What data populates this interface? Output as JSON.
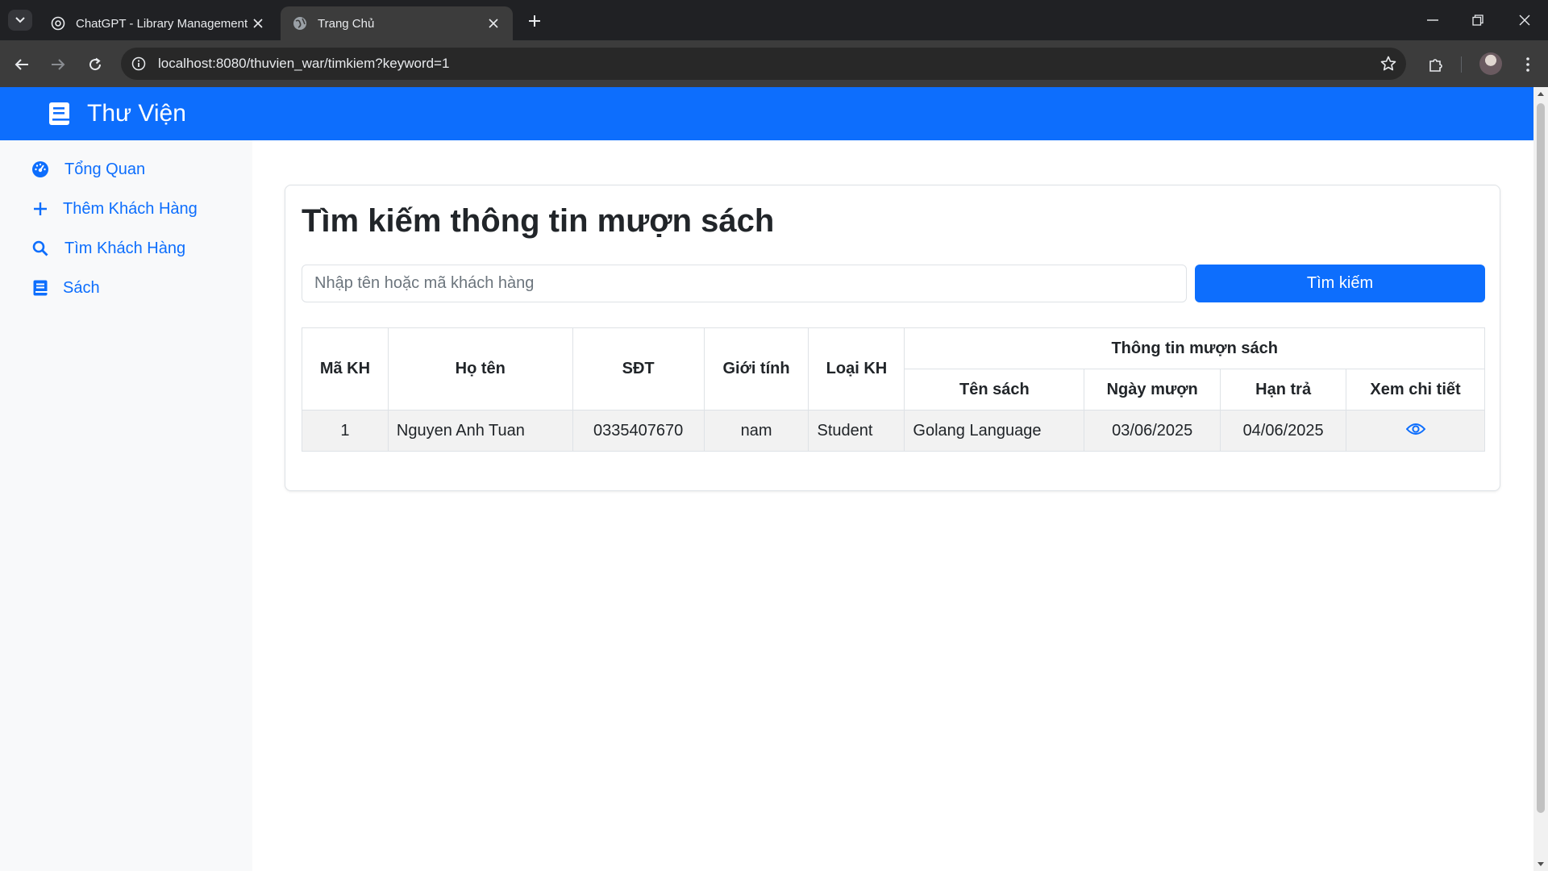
{
  "browser": {
    "tabs": [
      {
        "title": "ChatGPT - Library Management",
        "icon": "chatgpt-icon",
        "active": false
      },
      {
        "title": "Trang Chủ",
        "icon": "globe-icon",
        "active": true
      }
    ],
    "url": "localhost:8080/thuvien_war/timkiem?keyword=1"
  },
  "navbar": {
    "brand": "Thư Viện",
    "brand_icon": "book-icon",
    "color": "#0d6efd"
  },
  "sidebar": {
    "items": [
      {
        "label": "Tổng Quan",
        "icon": "dashboard-icon"
      },
      {
        "label": "Thêm Khách Hàng",
        "icon": "plus-icon"
      },
      {
        "label": "Tìm Khách Hàng",
        "icon": "search-icon"
      },
      {
        "label": "Sách",
        "icon": "book-icon"
      }
    ]
  },
  "main": {
    "title": "Tìm kiếm thông tin mượn sách",
    "search": {
      "placeholder": "Nhập tên hoặc mã khách hàng",
      "value": "",
      "button_label": "Tìm kiếm"
    },
    "table": {
      "headers": {
        "ma_kh": "Mã KH",
        "ho_ten": "Họ tên",
        "sdt": "SĐT",
        "gioi_tinh": "Giới tính",
        "loai_kh": "Loại KH",
        "group": "Thông tin mượn sách",
        "ten_sach": "Tên sách",
        "ngay_muon": "Ngày mượn",
        "han_tra": "Hạn trả",
        "xem_chi_tiet": "Xem chi tiết"
      },
      "rows": [
        {
          "ma_kh": "1",
          "ho_ten": "Nguyen Anh Tuan",
          "sdt": "0335407670",
          "gioi_tinh": "nam",
          "loai_kh": "Student",
          "ten_sach": "Golang Language",
          "ngay_muon": "03/06/2025",
          "han_tra": "04/06/2025",
          "action_icon": "eye-icon"
        }
      ]
    }
  }
}
